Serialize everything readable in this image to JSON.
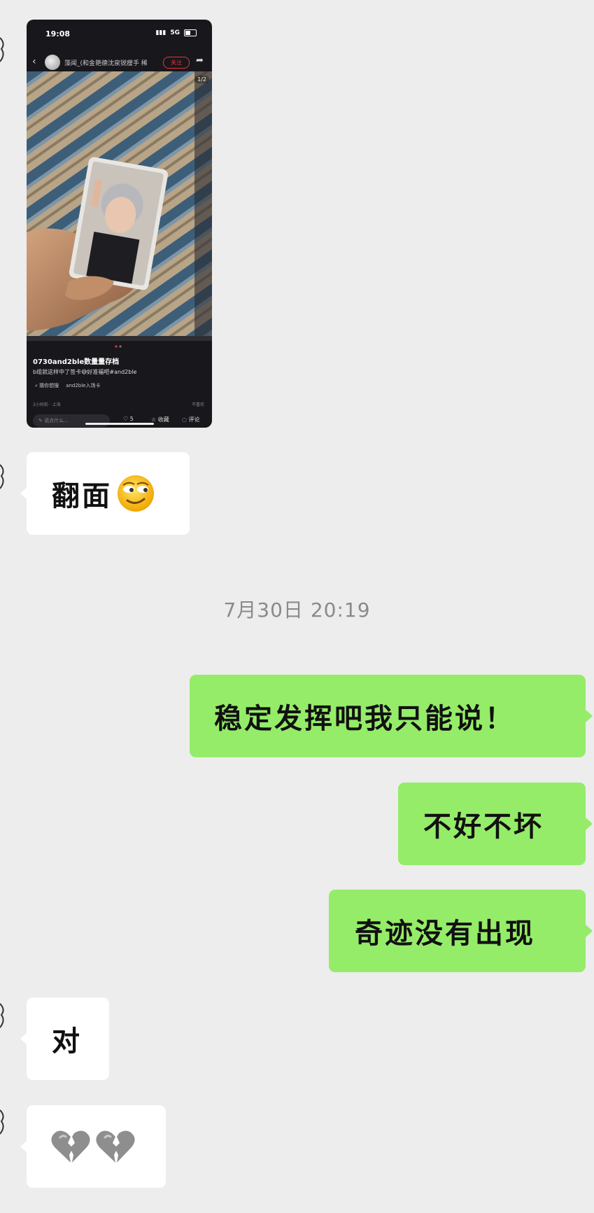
{
  "shared_post": {
    "status_time": "19:08",
    "network": "5G",
    "author": "藻闻_(和金艳德沈泉锐瘦手 稀...",
    "follow_label": "关注",
    "image_counter": "1/2",
    "title": "0730and2ble数量量存档",
    "description": "b组就这样中了签卡😅好准福吧#and2ble",
    "tags": [
      "猜你想搜",
      "and2ble入场卡"
    ],
    "posted": "2小时前 · 上海",
    "report": "不喜欢",
    "comment_placeholder": "说点什么...",
    "likes": "5",
    "collect_label": "收藏",
    "comment_label": "评论"
  },
  "messages": [
    {
      "side": "in",
      "text": "翻面",
      "emoji": "smirk-face"
    },
    {
      "side": "out",
      "text": "稳定发挥吧我只能说！"
    },
    {
      "side": "out",
      "text": "不好不坏"
    },
    {
      "side": "out",
      "text": "奇迹没有出现"
    },
    {
      "side": "in",
      "text": "对"
    },
    {
      "side": "in",
      "emoji": "broken-heart",
      "count": 2
    }
  ],
  "timestamp": "7月30日 20:19",
  "colors": {
    "background": "#ededed",
    "incoming_bubble": "#ffffff",
    "outgoing_bubble": "#95ec69"
  }
}
